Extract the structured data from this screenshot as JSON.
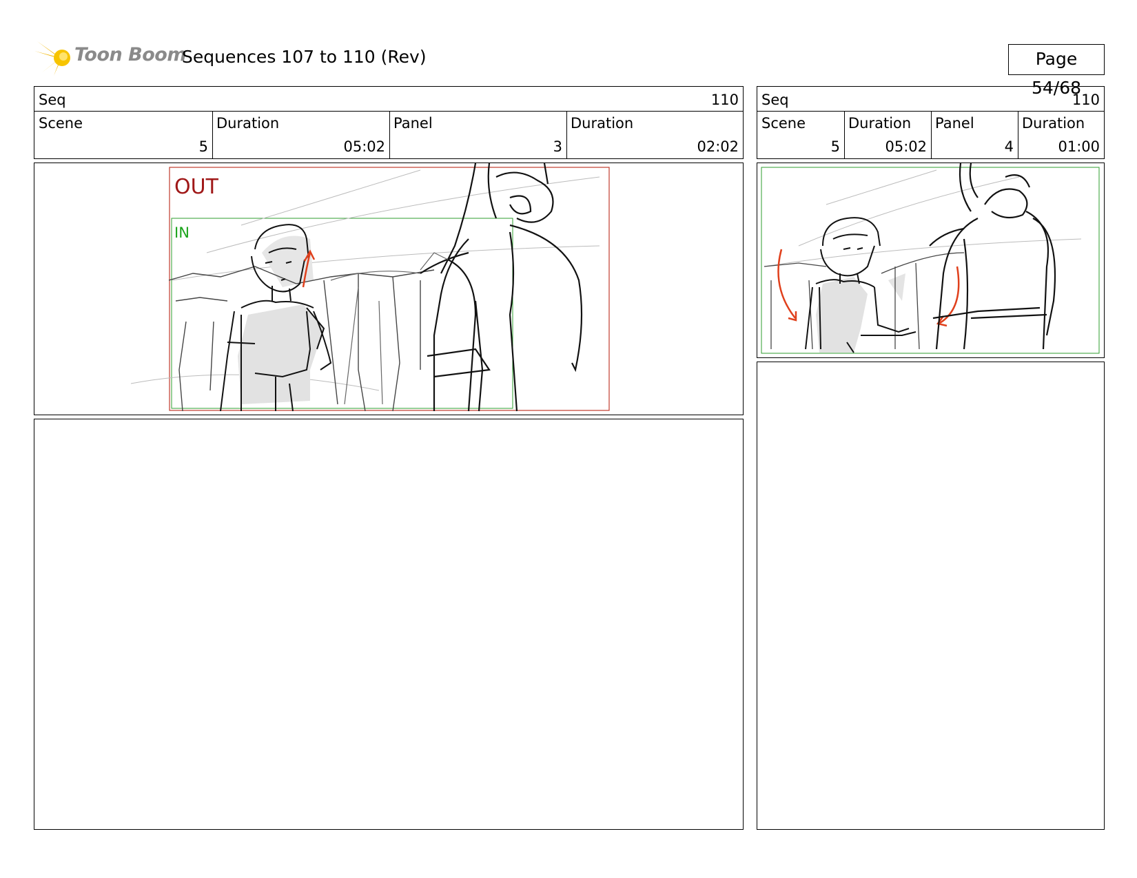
{
  "brand": {
    "name": "Toon Boom",
    "accent": "#f2b705"
  },
  "document": {
    "title": "Sequences 107 to 110 (Rev)",
    "page": "Page 54/68"
  },
  "panels": [
    {
      "seq_label": "Seq",
      "seq_value": "110",
      "scene_label": "Scene",
      "scene_value": "5",
      "scene_duration_label": "Duration",
      "scene_duration_value": "05:02",
      "panel_label": "Panel",
      "panel_value": "3",
      "panel_duration_label": "Duration",
      "panel_duration_value": "02:02",
      "frame_labels": {
        "out": "OUT",
        "in": "IN"
      },
      "colors": {
        "out_frame": "#c0392b",
        "in_frame": "#2e9e2e",
        "arrow": "#e0401c"
      }
    },
    {
      "seq_label": "Seq",
      "seq_value": "110",
      "scene_label": "Scene",
      "scene_value": "5",
      "scene_duration_label": "Duration",
      "scene_duration_value": "05:02",
      "panel_label": "Panel",
      "panel_value": "4",
      "panel_duration_label": "Duration",
      "panel_duration_value": "01:00",
      "colors": {
        "in_frame": "#2e9e2e",
        "arrow": "#e0401c"
      }
    }
  ]
}
